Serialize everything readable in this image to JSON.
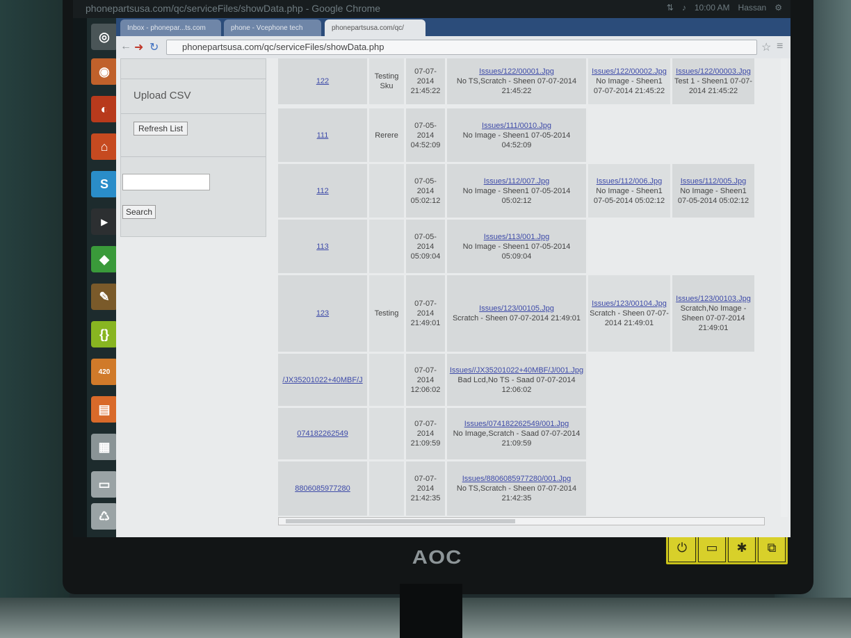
{
  "window_title": "phonepartsusa.com/qc/serviceFiles/showData.php - Google Chrome",
  "browser": {
    "tabs": [
      {
        "label": "Inbox - phonepar...ts.com",
        "active": false
      },
      {
        "label": "phone - Vcephone tech",
        "active": false
      },
      {
        "label": "phonepartsusa.com/qc/",
        "active": true
      }
    ],
    "url": "phonepartsusa.com/qc/serviceFiles/showData.php"
  },
  "tray": {
    "time": "10:00 AM",
    "user": "Hassan"
  },
  "monitor_brand": "AOC",
  "launcher_badge": "420",
  "sidebar": {
    "upload_label": "Upload CSV",
    "refresh_label": "Refresh List",
    "search_placeholder": "",
    "search_label": "Search"
  },
  "rows": [
    {
      "id": "122",
      "sku": "Testing Sku",
      "date": "07-07-2014 21:45:22",
      "issues": [
        {
          "link": "Issues/122/00001.Jpg",
          "desc": "No TS,Scratch - Sheen 07-07-2014 21:45:22"
        },
        {
          "link": "Issues/122/00002.Jpg",
          "desc": "No Image - Sheen1 07-07-2014 21:45:22"
        },
        {
          "link": "Issues/122/00003.Jpg",
          "desc": "Test 1 - Sheen1 07-07-2014 21:45:22"
        }
      ]
    },
    {
      "id": "111",
      "sku": "Rerere",
      "date": "07-05-2014 04:52:09",
      "issues": [
        {
          "link": "Issues/111/0010.Jpg",
          "desc": "No Image - Sheen1 07-05-2014 04:52:09"
        }
      ]
    },
    {
      "id": "112",
      "sku": "",
      "date": "07-05-2014 05:02:12",
      "issues": [
        {
          "link": "Issues/112/007.Jpg",
          "desc": "No Image - Sheen1 07-05-2014 05:02:12"
        },
        {
          "link": "Issues/112/006.Jpg",
          "desc": "No Image - Sheen1 07-05-2014 05:02:12"
        },
        {
          "link": "Issues/112/005.Jpg",
          "desc": "No Image - Sheen1 07-05-2014 05:02:12"
        }
      ]
    },
    {
      "id": "113",
      "sku": "",
      "date": "07-05-2014 05:09:04",
      "issues": [
        {
          "link": "Issues/113/001.Jpg",
          "desc": "No Image - Sheen1 07-05-2014 05:09:04"
        }
      ]
    },
    {
      "id": "123",
      "sku": "Testing",
      "date": "07-07-2014 21:49:01",
      "issues": [
        {
          "link": "Issues/123/00105.Jpg",
          "desc": "Scratch - Sheen 07-07-2014 21:49:01"
        },
        {
          "link": "Issues/123/00104.Jpg",
          "desc": "Scratch - Sheen 07-07-2014 21:49:01"
        },
        {
          "link": "Issues/123/00103.Jpg",
          "desc": "Scratch,No Image - Sheen 07-07-2014 21:49:01"
        }
      ]
    },
    {
      "id": "/JX35201022+40MBF/J",
      "sku": "",
      "date": "07-07-2014 12:06:02",
      "issues": [
        {
          "link": "Issues//JX35201022+40MBF/J/001.Jpg",
          "desc": "Bad Lcd,No TS - Saad 07-07-2014 12:06:02"
        }
      ]
    },
    {
      "id": "074182262549",
      "sku": "",
      "date": "07-07-2014 21:09:59",
      "issues": [
        {
          "link": "Issues/074182262549/001.Jpg",
          "desc": "No Image,Scratch - Saad 07-07-2014 21:09:59"
        }
      ]
    },
    {
      "id": "8806085977280",
      "sku": "",
      "date": "07-07-2014 21:42:35",
      "issues": [
        {
          "link": "Issues/8806085977280/001.Jpg",
          "desc": "No TS,Scratch - Sheen 07-07-2014 21:42:35"
        }
      ]
    }
  ],
  "colors": {
    "link": "#3d4aa8",
    "cell": "#d6d9da",
    "page": "#e9ebec"
  }
}
